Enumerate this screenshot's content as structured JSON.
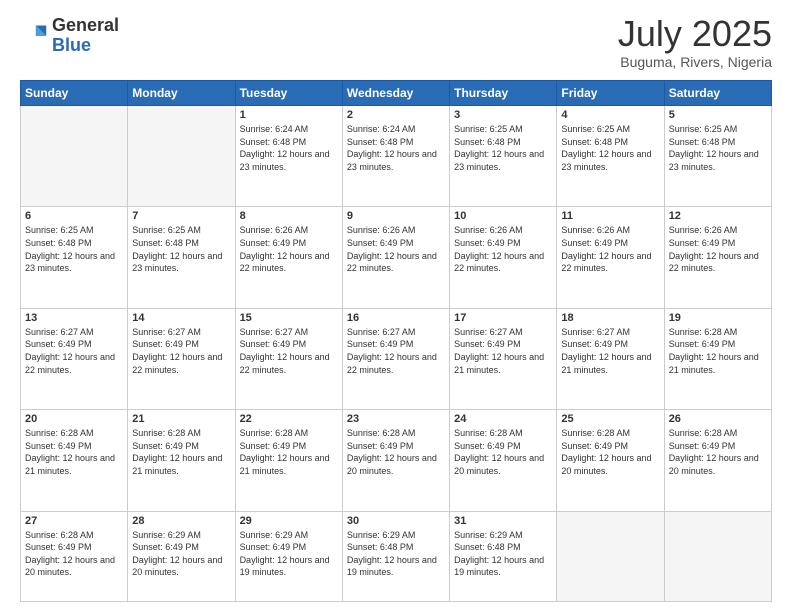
{
  "header": {
    "logo_general": "General",
    "logo_blue": "Blue",
    "month_title": "July 2025",
    "location": "Buguma, Rivers, Nigeria"
  },
  "weekdays": [
    "Sunday",
    "Monday",
    "Tuesday",
    "Wednesday",
    "Thursday",
    "Friday",
    "Saturday"
  ],
  "weeks": [
    [
      {
        "day": "",
        "empty": true
      },
      {
        "day": "",
        "empty": true
      },
      {
        "day": "1",
        "sunrise": "6:24 AM",
        "sunset": "6:48 PM",
        "daylight": "12 hours and 23 minutes."
      },
      {
        "day": "2",
        "sunrise": "6:24 AM",
        "sunset": "6:48 PM",
        "daylight": "12 hours and 23 minutes."
      },
      {
        "day": "3",
        "sunrise": "6:25 AM",
        "sunset": "6:48 PM",
        "daylight": "12 hours and 23 minutes."
      },
      {
        "day": "4",
        "sunrise": "6:25 AM",
        "sunset": "6:48 PM",
        "daylight": "12 hours and 23 minutes."
      },
      {
        "day": "5",
        "sunrise": "6:25 AM",
        "sunset": "6:48 PM",
        "daylight": "12 hours and 23 minutes."
      }
    ],
    [
      {
        "day": "6",
        "sunrise": "6:25 AM",
        "sunset": "6:48 PM",
        "daylight": "12 hours and 23 minutes."
      },
      {
        "day": "7",
        "sunrise": "6:25 AM",
        "sunset": "6:48 PM",
        "daylight": "12 hours and 23 minutes."
      },
      {
        "day": "8",
        "sunrise": "6:26 AM",
        "sunset": "6:49 PM",
        "daylight": "12 hours and 22 minutes."
      },
      {
        "day": "9",
        "sunrise": "6:26 AM",
        "sunset": "6:49 PM",
        "daylight": "12 hours and 22 minutes."
      },
      {
        "day": "10",
        "sunrise": "6:26 AM",
        "sunset": "6:49 PM",
        "daylight": "12 hours and 22 minutes."
      },
      {
        "day": "11",
        "sunrise": "6:26 AM",
        "sunset": "6:49 PM",
        "daylight": "12 hours and 22 minutes."
      },
      {
        "day": "12",
        "sunrise": "6:26 AM",
        "sunset": "6:49 PM",
        "daylight": "12 hours and 22 minutes."
      }
    ],
    [
      {
        "day": "13",
        "sunrise": "6:27 AM",
        "sunset": "6:49 PM",
        "daylight": "12 hours and 22 minutes."
      },
      {
        "day": "14",
        "sunrise": "6:27 AM",
        "sunset": "6:49 PM",
        "daylight": "12 hours and 22 minutes."
      },
      {
        "day": "15",
        "sunrise": "6:27 AM",
        "sunset": "6:49 PM",
        "daylight": "12 hours and 22 minutes."
      },
      {
        "day": "16",
        "sunrise": "6:27 AM",
        "sunset": "6:49 PM",
        "daylight": "12 hours and 22 minutes."
      },
      {
        "day": "17",
        "sunrise": "6:27 AM",
        "sunset": "6:49 PM",
        "daylight": "12 hours and 21 minutes."
      },
      {
        "day": "18",
        "sunrise": "6:27 AM",
        "sunset": "6:49 PM",
        "daylight": "12 hours and 21 minutes."
      },
      {
        "day": "19",
        "sunrise": "6:28 AM",
        "sunset": "6:49 PM",
        "daylight": "12 hours and 21 minutes."
      }
    ],
    [
      {
        "day": "20",
        "sunrise": "6:28 AM",
        "sunset": "6:49 PM",
        "daylight": "12 hours and 21 minutes."
      },
      {
        "day": "21",
        "sunrise": "6:28 AM",
        "sunset": "6:49 PM",
        "daylight": "12 hours and 21 minutes."
      },
      {
        "day": "22",
        "sunrise": "6:28 AM",
        "sunset": "6:49 PM",
        "daylight": "12 hours and 21 minutes."
      },
      {
        "day": "23",
        "sunrise": "6:28 AM",
        "sunset": "6:49 PM",
        "daylight": "12 hours and 20 minutes."
      },
      {
        "day": "24",
        "sunrise": "6:28 AM",
        "sunset": "6:49 PM",
        "daylight": "12 hours and 20 minutes."
      },
      {
        "day": "25",
        "sunrise": "6:28 AM",
        "sunset": "6:49 PM",
        "daylight": "12 hours and 20 minutes."
      },
      {
        "day": "26",
        "sunrise": "6:28 AM",
        "sunset": "6:49 PM",
        "daylight": "12 hours and 20 minutes."
      }
    ],
    [
      {
        "day": "27",
        "sunrise": "6:28 AM",
        "sunset": "6:49 PM",
        "daylight": "12 hours and 20 minutes."
      },
      {
        "day": "28",
        "sunrise": "6:29 AM",
        "sunset": "6:49 PM",
        "daylight": "12 hours and 20 minutes."
      },
      {
        "day": "29",
        "sunrise": "6:29 AM",
        "sunset": "6:49 PM",
        "daylight": "12 hours and 19 minutes."
      },
      {
        "day": "30",
        "sunrise": "6:29 AM",
        "sunset": "6:48 PM",
        "daylight": "12 hours and 19 minutes."
      },
      {
        "day": "31",
        "sunrise": "6:29 AM",
        "sunset": "6:48 PM",
        "daylight": "12 hours and 19 minutes."
      },
      {
        "day": "",
        "empty": true
      },
      {
        "day": "",
        "empty": true
      }
    ]
  ]
}
